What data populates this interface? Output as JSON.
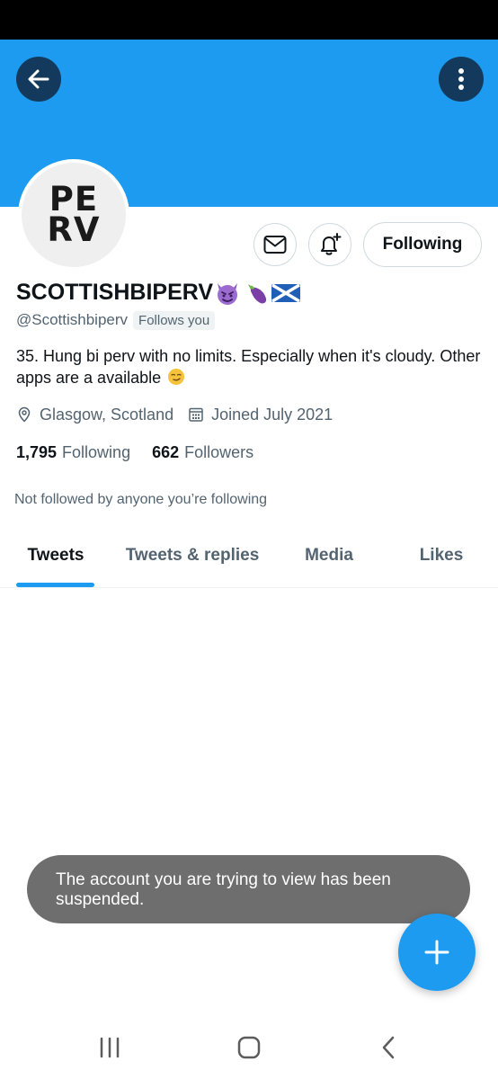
{
  "profile": {
    "avatar_text_line1": "PE",
    "avatar_text_line2": "RV",
    "display_name": "SCOTTISHBIPERV",
    "handle": "@Scottishbiperv",
    "follows_you": "Follows you",
    "bio": "35. Hung bi perv with no limits. Especially when it's cloudy. Other apps are a available",
    "location": "Glasgow, Scotland",
    "joined": "Joined July 2021",
    "following_count": "1,795",
    "following_label": "Following",
    "followers_count": "662",
    "followers_label": "Followers",
    "not_followed": "Not followed by anyone you’re following"
  },
  "actions": {
    "follow_button_label": "Following",
    "message_icon": "mail-icon",
    "bell_icon": "bell-plus-icon"
  },
  "tabs": [
    {
      "label": "Tweets",
      "active": true
    },
    {
      "label": "Tweets & replies",
      "active": false
    },
    {
      "label": "Media",
      "active": false
    },
    {
      "label": "Likes",
      "active": false
    }
  ],
  "toast": {
    "message": "The account you are trying to view has been suspended."
  },
  "icons": {
    "name_emojis": [
      "smiling-imp-emoji",
      "eggplant-emoji",
      "scotland-flag-emoji"
    ],
    "bio_emoji": "smirking-face-emoji",
    "fab": "plus-icon",
    "nav": [
      "recents-icon",
      "home-icon",
      "back-icon"
    ]
  },
  "colors": {
    "banner": "#1d9bf0",
    "accent": "#1d9bf0",
    "header_buttons": "#133a5c",
    "toast_bg": "#6e6e6e",
    "secondary_text": "#536471"
  }
}
